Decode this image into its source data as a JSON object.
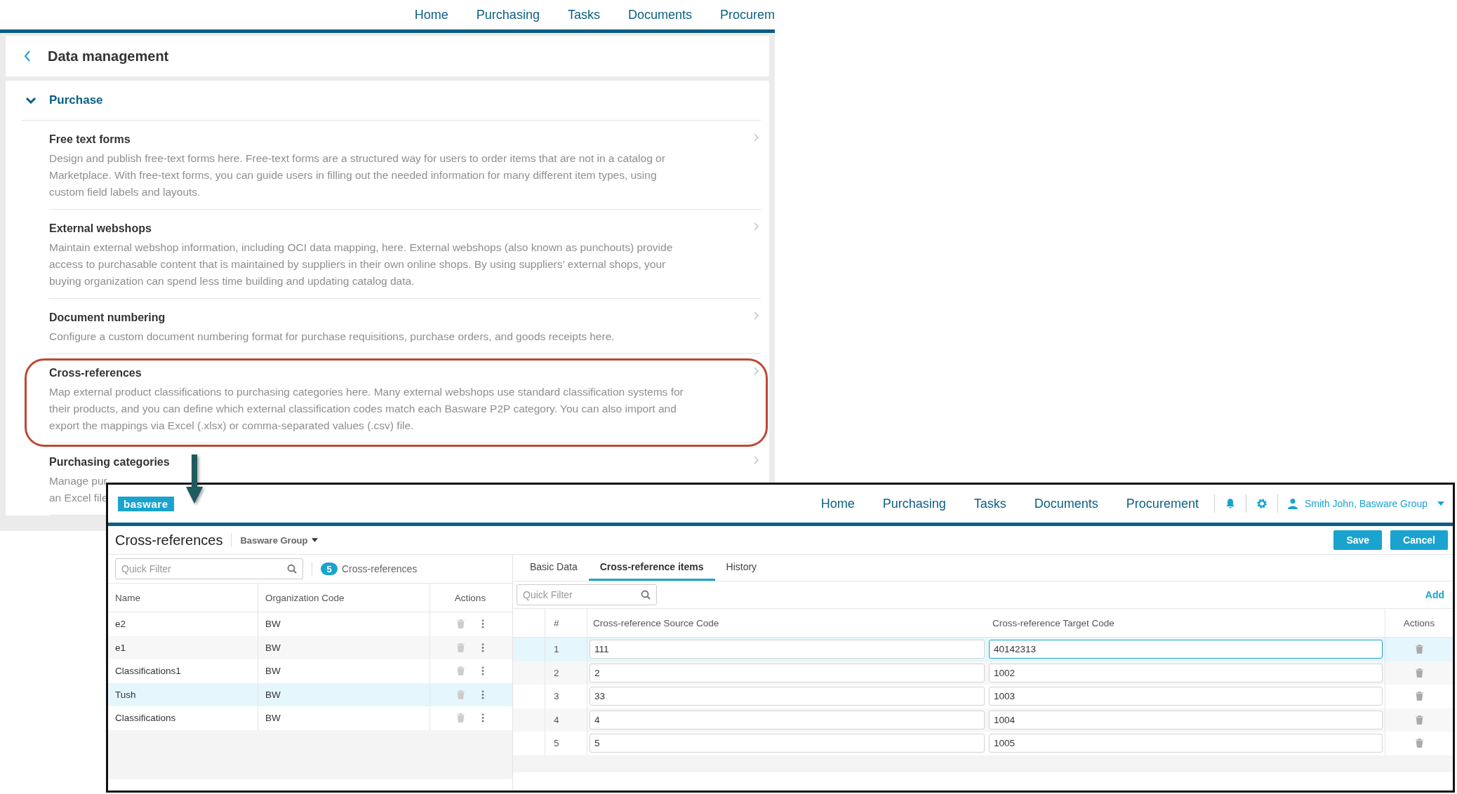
{
  "background_page": {
    "nav": [
      "Home",
      "Purchasing",
      "Tasks",
      "Documents",
      "Procurem"
    ],
    "title": "Data management",
    "section": {
      "title": "Purchase",
      "expanded": true,
      "items": [
        {
          "title": "Free text forms",
          "highlighted": false,
          "description": [
            "Design and publish free-text forms here. Free-text forms are a structured way for users to order items that are not in a catalog or",
            "Marketplace. With free-text forms, you can guide users in filling out the needed information for many different item types, using",
            "custom field labels and layouts."
          ]
        },
        {
          "title": "External webshops",
          "highlighted": false,
          "description": [
            "Maintain external webshop information, including OCI data mapping, here. External webshops (also known as punchouts) provide",
            "access to purchasable content that is maintained by suppliers in their own online shops. By using suppliers’ external shops, your",
            "buying organization can spend less time building and updating catalog data."
          ]
        },
        {
          "title": "Document numbering",
          "highlighted": false,
          "description": [
            "Configure a custom document numbering format for purchase requisitions, purchase orders, and goods receipts here."
          ]
        },
        {
          "title": "Cross-references",
          "highlighted": true,
          "description": [
            "Map external product classifications to purchasing categories here. Many external webshops use standard classification systems for",
            "their products, and you can define which external classification codes match each Basware P2P category. You can also import and",
            "export the mappings via Excel (.xlsx) or comma-separated values (.csv) file."
          ]
        },
        {
          "title": "Purchasing categories",
          "highlighted": false,
          "description": [
            "Manage pur",
            "an Excel file"
          ]
        }
      ]
    }
  },
  "window": {
    "logo": "basware",
    "nav": [
      "Home",
      "Purchasing",
      "Tasks",
      "Documents",
      "Procurement"
    ],
    "user": "Smith John, Basware Group",
    "title": "Cross-references",
    "organization": "Basware Group",
    "buttons": [
      "Save",
      "Cancel"
    ],
    "list": {
      "filter_placeholder": "Quick Filter",
      "count": "5",
      "count_label": "Cross-references",
      "columns": [
        "Name",
        "Organization Code",
        "Actions"
      ],
      "rows": [
        {
          "name": "e2",
          "code": "BW",
          "selected": false
        },
        {
          "name": "e1",
          "code": "BW",
          "selected": false
        },
        {
          "name": "Classifications1",
          "code": "BW",
          "selected": false
        },
        {
          "name": "Tush",
          "code": "BW",
          "selected": true
        },
        {
          "name": "Classifications",
          "code": "BW",
          "selected": false
        }
      ]
    },
    "tabs": [
      {
        "label": "Basic Data",
        "selected": false
      },
      {
        "label": "Cross-reference items",
        "selected": true
      },
      {
        "label": "History",
        "selected": false
      }
    ],
    "items": {
      "filter_placeholder": "Quick Filter",
      "add": "Add",
      "columns": [
        "#",
        "Cross-reference Source Code",
        "Cross-reference Target Code",
        "Actions"
      ],
      "rows": [
        {
          "index": "1",
          "source": "111",
          "target": "40142313",
          "selected": true
        },
        {
          "index": "2",
          "source": "2",
          "target": "1002",
          "selected": false
        },
        {
          "index": "3",
          "source": "33",
          "target": "1003",
          "selected": false
        },
        {
          "index": "4",
          "source": "4",
          "target": "1004",
          "selected": false
        },
        {
          "index": "5",
          "source": "5",
          "target": "1005",
          "selected": false
        }
      ]
    }
  }
}
